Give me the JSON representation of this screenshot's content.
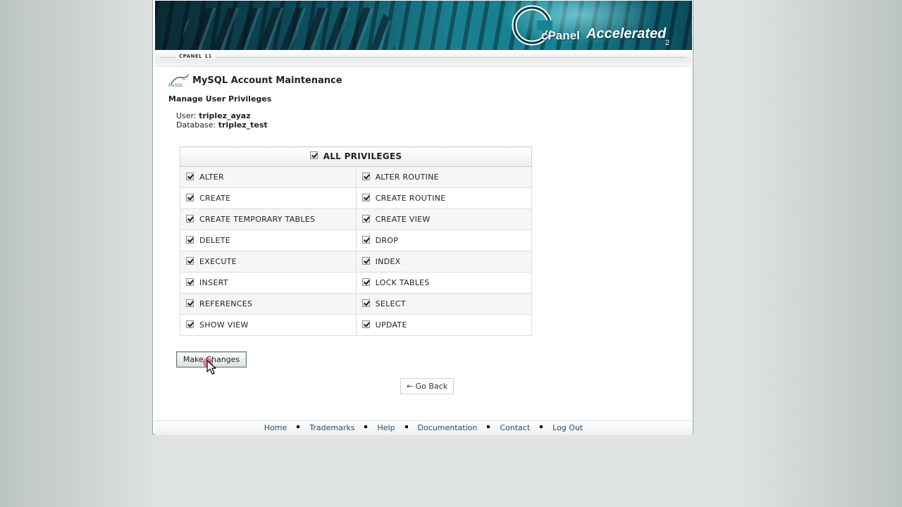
{
  "header": {
    "logo_cpanel": "cPanel",
    "logo_accelerated": "Accelerated",
    "logo_version": "2",
    "subbar_tag": "CPANEL 11"
  },
  "page": {
    "title": "MySQL Account Maintenance",
    "section_title": "Manage User Privileges",
    "user_label": "User:",
    "user_value": "triplez_ayaz",
    "database_label": "Database:",
    "database_value": "triplez_test"
  },
  "privileges": {
    "all_label": "ALL PRIVILEGES",
    "all_checked": true,
    "rows": [
      {
        "left": "ALTER",
        "right": "ALTER ROUTINE"
      },
      {
        "left": "CREATE",
        "right": "CREATE ROUTINE"
      },
      {
        "left": "CREATE TEMPORARY TABLES",
        "right": "CREATE VIEW"
      },
      {
        "left": "DELETE",
        "right": "DROP"
      },
      {
        "left": "EXECUTE",
        "right": "INDEX"
      },
      {
        "left": "INSERT",
        "right": "LOCK TABLES"
      },
      {
        "left": "REFERENCES",
        "right": "SELECT"
      },
      {
        "left": "SHOW VIEW",
        "right": "UPDATE"
      }
    ]
  },
  "actions": {
    "make_changes": "Make Changes",
    "go_back": "← Go Back"
  },
  "footer": {
    "links": [
      "Home",
      "Trademarks",
      "Help",
      "Documentation",
      "Contact",
      "Log Out"
    ]
  },
  "colors": {
    "banner_teal": "#1a7f8f",
    "link": "#2c4a66",
    "click_indicator": "#dc2850"
  }
}
